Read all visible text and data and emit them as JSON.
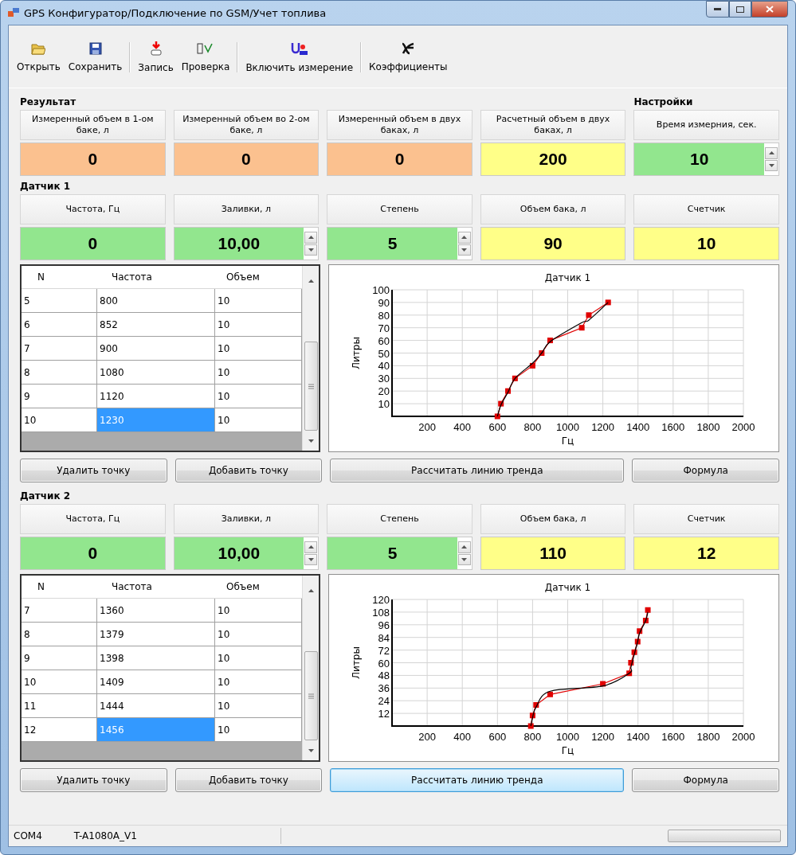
{
  "window": {
    "title": "GPS Конфигуратор/Подключение по GSM/Учет топлива"
  },
  "toolbar": [
    {
      "label": "Открыть",
      "separator_before": false
    },
    {
      "label": "Сохранить",
      "separator_before": false
    },
    {
      "label": "Запись",
      "separator_before": true
    },
    {
      "label": "Проверка",
      "separator_before": false
    },
    {
      "label": "Включить измерение",
      "separator_before": true
    },
    {
      "label": "Коэффициенты",
      "separator_before": true
    }
  ],
  "result": {
    "title": "Результат",
    "settings_title": "Настройки",
    "cells": [
      {
        "label": "Измеренный объем в 1-ом баке, л",
        "value": "0",
        "color": "#fbc18f",
        "kind": "plain"
      },
      {
        "label": "Измеренный объем во 2-ом баке, л",
        "value": "0",
        "color": "#fbc18f",
        "kind": "plain"
      },
      {
        "label": "Измеренный объем в двух баках, л",
        "value": "0",
        "color": "#fbc18f",
        "kind": "plain"
      },
      {
        "label": "Расчетный объем в двух баках, л",
        "value": "200",
        "color": "#ffff88",
        "kind": "plain"
      },
      {
        "label": "Время измерния, сек.",
        "value": "10",
        "color": "#92e68e",
        "kind": "spin"
      }
    ]
  },
  "sensors": [
    {
      "title": "Датчик 1",
      "cells": [
        {
          "label": "Частота, Гц",
          "value": "0",
          "color": "#92e68e",
          "kind": "plain"
        },
        {
          "label": "Заливки, л",
          "value": "10,00",
          "color": "#92e68e",
          "kind": "spin"
        },
        {
          "label": "Степень",
          "value": "5",
          "color": "#92e68e",
          "kind": "spin"
        },
        {
          "label": "Объем бака, л",
          "value": "90",
          "color": "#ffff88",
          "kind": "plain"
        },
        {
          "label": "Счетчик",
          "value": "10",
          "color": "#ffff88",
          "kind": "plain"
        }
      ],
      "table": {
        "columns": [
          "N",
          "Частота",
          "Объем"
        ],
        "rows": [
          {
            "n": "5",
            "freq": "800",
            "volume": "10",
            "selected": false
          },
          {
            "n": "6",
            "freq": "852",
            "volume": "10",
            "selected": false
          },
          {
            "n": "7",
            "freq": "900",
            "volume": "10",
            "selected": false
          },
          {
            "n": "8",
            "freq": "1080",
            "volume": "10",
            "selected": false
          },
          {
            "n": "9",
            "freq": "1120",
            "volume": "10",
            "selected": false
          },
          {
            "n": "10",
            "freq": "1230",
            "volume": "10",
            "selected": true
          }
        ]
      },
      "chart_data": {
        "type": "line",
        "title": "Датчик 1",
        "xlabel": "Гц",
        "ylabel": "Литры",
        "x": [
          600,
          620,
          660,
          700,
          800,
          852,
          900,
          1080,
          1120,
          1230
        ],
        "series": [
          {
            "color": "#e00000",
            "marker": "square",
            "values": [
              0,
              10,
              20,
              30,
              40,
              50,
              60,
              70,
              80,
              90
            ]
          },
          {
            "color": "#000000",
            "values": [
              0,
              9,
              19,
              30,
              42,
              50,
              59,
              74,
              76,
              90
            ]
          }
        ],
        "grid": true,
        "xlim": [
          0,
          2000
        ],
        "ylim": [
          0,
          100
        ],
        "xticks": [
          200,
          400,
          600,
          800,
          1000,
          1200,
          1400,
          1600,
          1800,
          2000
        ],
        "yticks": [
          10,
          20,
          30,
          40,
          50,
          60,
          70,
          80,
          90,
          100
        ]
      },
      "buttons": [
        {
          "label": "Удалить точку",
          "focused": false
        },
        {
          "label": "Добавить точку",
          "focused": false
        },
        {
          "label": "Рассчитать линию тренда",
          "focused": false
        },
        {
          "label": "Формула",
          "focused": false
        }
      ]
    },
    {
      "title": "Датчик 2",
      "cells": [
        {
          "label": "Частота, Гц",
          "value": "0",
          "color": "#92e68e",
          "kind": "plain"
        },
        {
          "label": "Заливки, л",
          "value": "10,00",
          "color": "#92e68e",
          "kind": "spin"
        },
        {
          "label": "Степень",
          "value": "5",
          "color": "#92e68e",
          "kind": "spin"
        },
        {
          "label": "Объем бака, л",
          "value": "110",
          "color": "#ffff88",
          "kind": "plain"
        },
        {
          "label": "Счетчик",
          "value": "12",
          "color": "#ffff88",
          "kind": "plain"
        }
      ],
      "table": {
        "columns": [
          "N",
          "Частота",
          "Объем"
        ],
        "rows": [
          {
            "n": "7",
            "freq": "1360",
            "volume": "10",
            "selected": false
          },
          {
            "n": "8",
            "freq": "1379",
            "volume": "10",
            "selected": false
          },
          {
            "n": "9",
            "freq": "1398",
            "volume": "10",
            "selected": false
          },
          {
            "n": "10",
            "freq": "1409",
            "volume": "10",
            "selected": false
          },
          {
            "n": "11",
            "freq": "1444",
            "volume": "10",
            "selected": false
          },
          {
            "n": "12",
            "freq": "1456",
            "volume": "10",
            "selected": true
          }
        ]
      },
      "chart_data": {
        "type": "line",
        "title": "Датчик 1",
        "xlabel": "Гц",
        "ylabel": "Литры",
        "x": [
          790,
          800,
          820,
          900,
          1200,
          1350,
          1360,
          1379,
          1398,
          1409,
          1444,
          1456
        ],
        "series": [
          {
            "color": "#e00000",
            "marker": "square",
            "values": [
              0,
              10,
              20,
              30,
              40,
              50,
              60,
              70,
              80,
              90,
              100,
              110
            ]
          },
          {
            "color": "#000000",
            "values": [
              0,
              8,
              18,
              33,
              38,
              50,
              56,
              68,
              80,
              88,
              100,
              108
            ]
          }
        ],
        "grid": true,
        "xlim": [
          0,
          2000
        ],
        "ylim": [
          0,
          120
        ],
        "xticks": [
          200,
          400,
          600,
          800,
          1000,
          1200,
          1400,
          1600,
          1800,
          2000
        ],
        "yticks": [
          12,
          24,
          36,
          48,
          60,
          72,
          84,
          96,
          108,
          120
        ]
      },
      "buttons": [
        {
          "label": "Удалить точку",
          "focused": false
        },
        {
          "label": "Добавить точку",
          "focused": false
        },
        {
          "label": "Рассчитать линию тренда",
          "focused": true
        },
        {
          "label": "Формула",
          "focused": false
        }
      ]
    }
  ],
  "status_bar": {
    "port": "COM4",
    "device": "T-A1080A_V1",
    "progress": {
      "level": 0
    }
  }
}
